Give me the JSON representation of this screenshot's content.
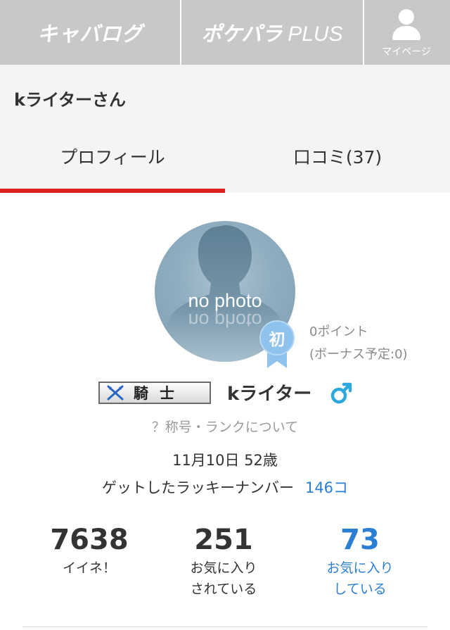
{
  "nav": {
    "logo1": "キャバログ",
    "logo2_kana": "ポケパラ",
    "logo2_plus": "PLUS",
    "mypage_label": "マイページ",
    "mypage_icon": "user-icon"
  },
  "header": {
    "title": "kライターさん"
  },
  "tabs": [
    {
      "label": "プロフィール",
      "active": true
    },
    {
      "label": "口コミ(37)",
      "active": false
    }
  ],
  "profile": {
    "avatar_text": "no photo",
    "badge": "初",
    "points": "0ポイント",
    "bonus": "(ボーナス予定:0)",
    "rank": "騎士",
    "username": "kライター",
    "gender_icon": "male-icon",
    "rank_link": "？称号・ランクについて",
    "birth": "11月10日 52歳",
    "lucky_label": "ゲットしたラッキーナンバー",
    "lucky_count": "146コ"
  },
  "stats": [
    {
      "value": "7638",
      "label_line1": "イイネ！",
      "label_line2": ""
    },
    {
      "value": "251",
      "label_line1": "お気に入り",
      "label_line2": "されている"
    },
    {
      "value": "73",
      "label_line1": "お気に入り",
      "label_line2": "している"
    }
  ],
  "colors": {
    "accent_red": "#d8201e",
    "link_blue": "#2a7fd4",
    "nav_gray": "#c8c8c8",
    "badge_blue": "#8fc2ec"
  }
}
